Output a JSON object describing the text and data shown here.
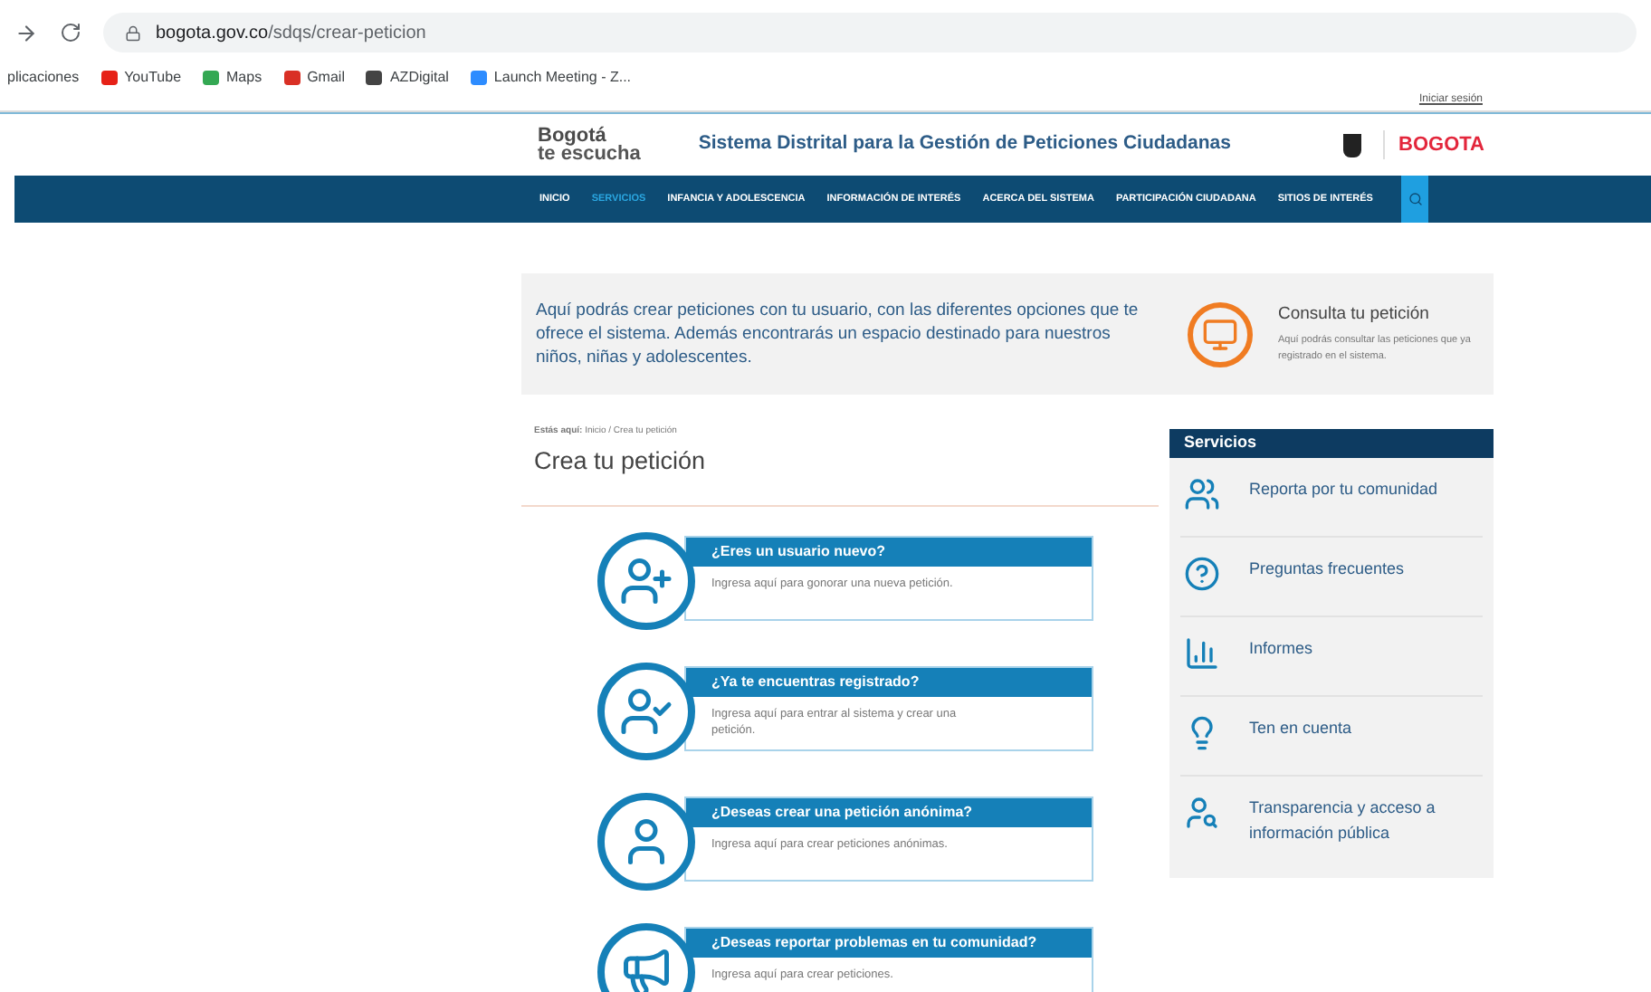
{
  "browser": {
    "url_host": "bogota.gov.co",
    "url_path": "/sdqs/crear-peticion",
    "bookmarks": [
      "plicaciones",
      "YouTube",
      "Maps",
      "Gmail",
      "AZDigital",
      "Launch Meeting - Z..."
    ]
  },
  "login_link": "Iniciar sesión",
  "header": {
    "logo_line1": "Bogotá",
    "logo_line2": "te escucha",
    "title": "Sistema Distrital para la Gestión de Peticiones Ciudadanas",
    "brand": "BOGOTA"
  },
  "nav": [
    {
      "label": "INICIO",
      "selected": false
    },
    {
      "label": "SERVICIOS",
      "selected": true
    },
    {
      "label": "INFANCIA Y ADOLESCENCIA",
      "selected": false
    },
    {
      "label": "INFORMACIÓN DE INTERÉS",
      "selected": false
    },
    {
      "label": "ACERCA DEL SISTEMA",
      "selected": false
    },
    {
      "label": "PARTICIPACIÓN CIUDADANA",
      "selected": false
    },
    {
      "label": "SITIOS DE INTERÉS",
      "selected": false
    }
  ],
  "intro": {
    "text": "Aquí podrás crear peticiones con tu usuario, con las diferentes opciones que te ofrece el sistema. Además encontrarás un espacio destinado para nuestros niños, niñas y adolescentes.",
    "consult_title": "Consulta tu petición",
    "consult_text": "Aquí podrás consultar las peticiones que ya registrado en el sistema."
  },
  "breadcrumb": {
    "label": "Estás aquí:",
    "path": "Inicio / Crea tu petición"
  },
  "page_title": "Crea tu petición",
  "cards": [
    {
      "kind": "new",
      "title": "¿Eres un usuario nuevo?",
      "text": "Ingresa aquí para gonorar una nueva petición."
    },
    {
      "kind": "registered",
      "title": "¿Ya te encuentras registrado?",
      "text": "Ingresa aquí para entrar al sistema y crear una petición."
    },
    {
      "kind": "anonymous",
      "title": "¿Deseas crear una petición anónima?",
      "text": "Ingresa aquí para crear peticiones anónimas."
    },
    {
      "kind": "report",
      "title": "¿Deseas reportar problemas en tu comunidad?",
      "text": "Ingresa aquí para crear peticiones."
    }
  ],
  "sidebar": {
    "title": "Servicios",
    "items": [
      {
        "kind": "community",
        "label": "Reporta por tu comunidad"
      },
      {
        "kind": "faq",
        "label": "Preguntas frecuentes"
      },
      {
        "kind": "reports",
        "label": "Informes"
      },
      {
        "kind": "tips",
        "label": "Ten en cuenta"
      },
      {
        "kind": "transparency",
        "label": "Transparencia y acceso a información pública"
      }
    ]
  }
}
